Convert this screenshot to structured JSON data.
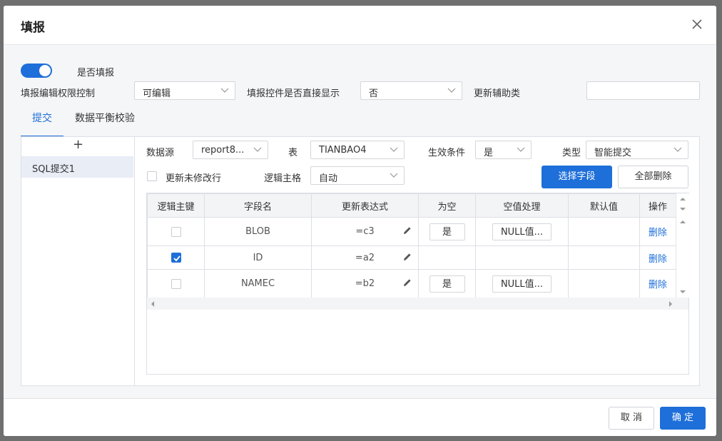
{
  "dialog": {
    "title": "填报"
  },
  "settings": {
    "fill_toggle_label": "是否填报",
    "permission_label": "填报编辑权限控制",
    "permission_value": "可编辑",
    "direct_display_label": "填报控件是否直接显示",
    "direct_display_value": "否",
    "aux_label": "更新辅助类",
    "aux_value": ""
  },
  "tabs": [
    {
      "label": "提交"
    },
    {
      "label": "数据平衡校验"
    }
  ],
  "sidebar": {
    "add_symbol": "+",
    "items": [
      {
        "label": "SQL提交1"
      }
    ]
  },
  "form": {
    "datasource_label": "数据源",
    "datasource_value": "report8...",
    "table_label": "表",
    "table_value": "TIANBAO4",
    "condition_label": "生效条件",
    "condition_value": "是",
    "type_label": "类型",
    "type_value": "智能提交",
    "update_unmodified_label": "更新未修改行",
    "logic_pk_label": "逻辑主格",
    "logic_pk_value": "自动",
    "select_fields_label": "选择字段",
    "delete_all_label": "全部删除"
  },
  "table": {
    "columns": [
      "逻辑主键",
      "字段名",
      "更新表达式",
      "为空",
      "空值处理",
      "默认值",
      "操作"
    ],
    "rows": [
      {
        "checked": false,
        "field": "BLOB",
        "expr": "=c3",
        "nullable": "是",
        "null_handle": "NULL值...",
        "default": "",
        "action": "删除"
      },
      {
        "checked": true,
        "field": "ID",
        "expr": "=a2",
        "nullable": "",
        "null_handle": "",
        "default": "",
        "action": "删除"
      },
      {
        "checked": false,
        "field": "NAMEC",
        "expr": "=b2",
        "nullable": "是",
        "null_handle": "NULL值...",
        "default": "",
        "action": "删除"
      }
    ]
  },
  "footer": {
    "cancel_label": "取 消",
    "ok_label": "确 定"
  },
  "colors": {
    "primary": "#1e6fd9",
    "selected_row": "#e8edf6"
  }
}
